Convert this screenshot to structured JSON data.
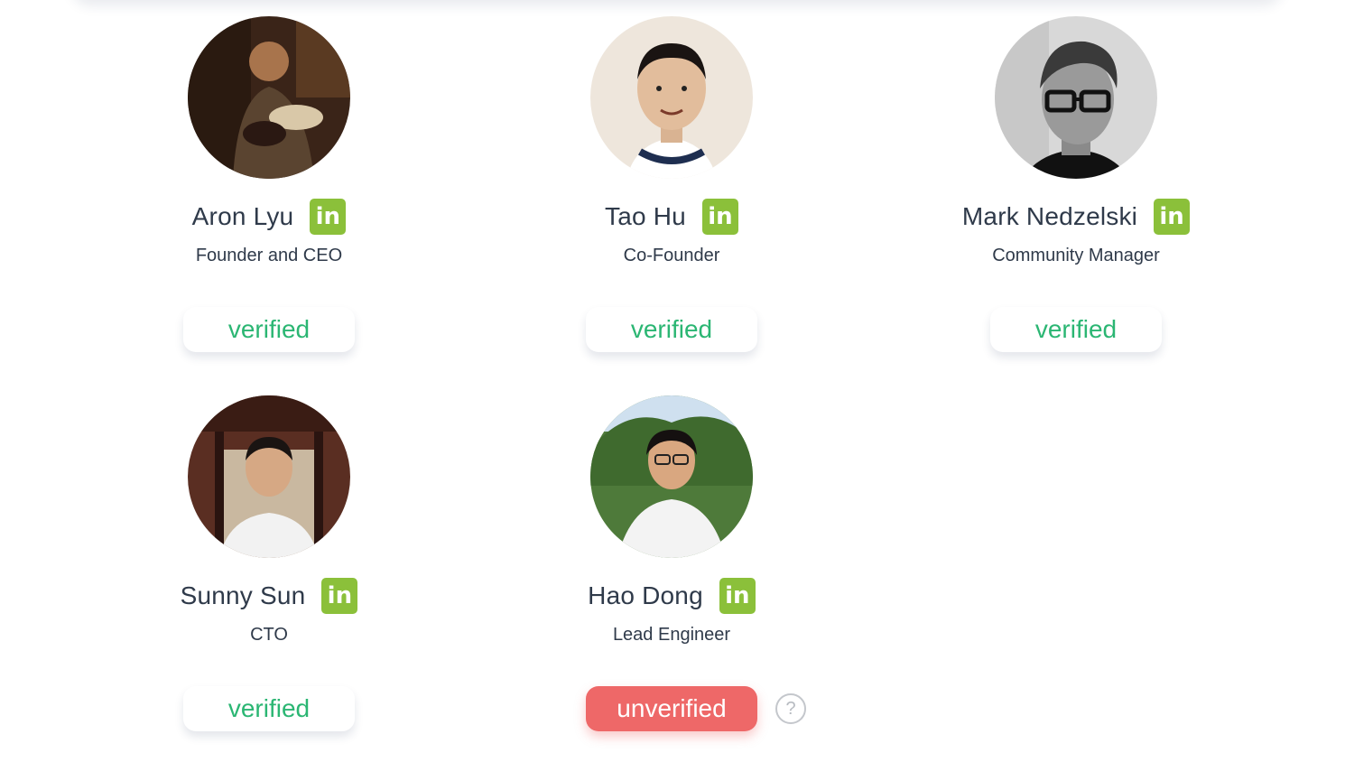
{
  "team": [
    {
      "name": "Aron Lyu",
      "role": "Founder and CEO",
      "status": "verified",
      "linkedin_icon": "linkedin-icon",
      "linkedin_label": "in"
    },
    {
      "name": "Tao Hu",
      "role": "Co-Founder",
      "status": "verified",
      "linkedin_icon": "linkedin-icon",
      "linkedin_label": "in"
    },
    {
      "name": "Mark Nedzelski",
      "role": "Community Manager",
      "status": "verified",
      "linkedin_icon": "linkedin-icon",
      "linkedin_label": "in"
    },
    {
      "name": "Sunny Sun",
      "role": "CTO",
      "status": "verified",
      "linkedin_icon": "linkedin-icon",
      "linkedin_label": "in"
    },
    {
      "name": "Hao Dong",
      "role": "Lead Engineer",
      "status": "unverified",
      "linkedin_icon": "linkedin-icon",
      "linkedin_label": "in"
    }
  ],
  "help": {
    "icon": "question-icon",
    "glyph": "?"
  },
  "colors": {
    "verified_text": "#2bb673",
    "unverified_bg": "#ee6868",
    "linkedin_bg": "#8bc03a",
    "name_text": "#2f3a4a"
  }
}
